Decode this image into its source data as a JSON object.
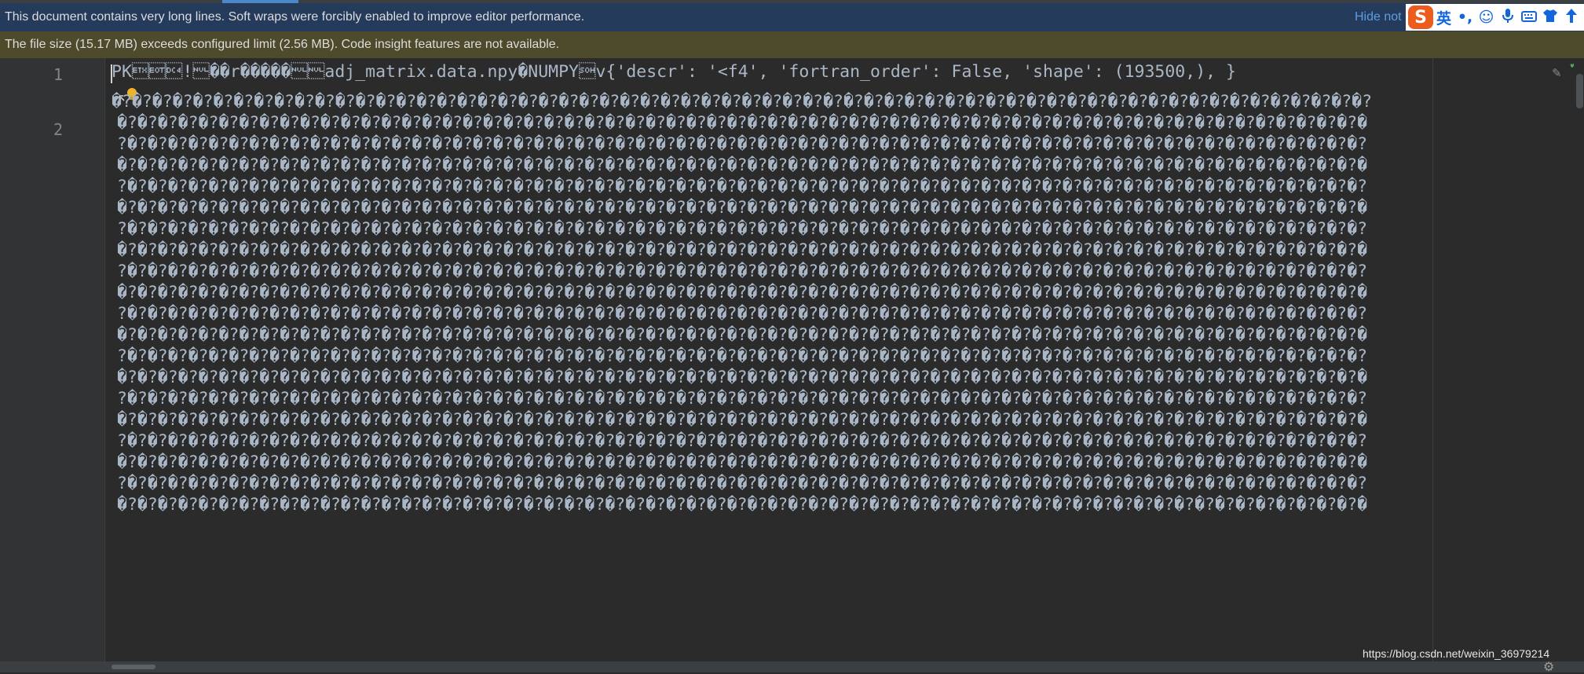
{
  "notification": {
    "message": "This document contains very long lines. Soft wraps were forcibly enabled to improve editor performance.",
    "hide_label": "Hide not"
  },
  "warning": {
    "message": "The file size (15.17 MB) exceeds configured limit (2.56 MB). Code insight features are not available."
  },
  "ime_toolbar": {
    "logo": "S",
    "lang": "英",
    "punct": "•,",
    "emoji_icon": "smiley-icon",
    "mic_icon": "microphone-icon",
    "keyboard_icon": "keyboard-icon",
    "skin_icon": "shirt-icon",
    "more_icon": "arrow-up-icon"
  },
  "editor": {
    "line_numbers": [
      "1",
      "2"
    ],
    "line1": "PK\u0003\u0004\u0014!\u0000��r�����\u0000\u0000adj_matrix.data.npy�NUMPY\u0001v{'descr': '<f4', 'fortran_order': False, 'shape': (193500,), }",
    "wrapped_lines": [
      "�?�?�?�?�?�?�?�?�?�?�?�?�?�?�?�?�?�?�?�?�?�?�?�?�?�?�?�?�?�?�?�?�?�?�?�?�?�?�?�?�?�?�?�?�?�?�?�?�?�?�?�?�?�?�?�?�?�?�?�?�?�?",
      "�?�?�?�?�?�?�?�?�?�?�?�?�?�?�?�?�?�?�?�?�?�?�?�?�?�?�?�?�?�?�?�?�?�?�?�?�?�?�?�?�?�?�?�?�?�?�?�?�?�?�?�?�?�?�?�?�?�?�?�?�?�",
      "?�?�?�?�?�?�?�?�?�?�?�?�?�?�?�?�?�?�?�?�?�?�?�?�?�?�?�?�?�?�?�?�?�?�?�?�?�?�?�?�?�?�?�?�?�?�?�?�?�?�?�?�?�?�?�?�?�?�?�?�?�?",
      "�?�?�?�?�?�?�?�?�?�?�?�?�?�?�?�?�?�?�?�?�?�?�?�?�?�?�?�?�?�?�?�?�?�?�?�?�?�?�?�?�?�?�?�?�?�?�?�?�?�?�?�?�?�?�?�?�?�?�?�?�?�",
      "?�?�?�?�?�?�?�?�?�?�?�?�?�?�?�?�?�?�?�?�?�?�?�?�?�?�?�?�?�?�?�?�?�?�?�?�?�?�?�?�?�?�?�?�?�?�?�?�?�?�?�?�?�?�?�?�?�?�?�?�?�?",
      "�?�?�?�?�?�?�?�?�?�?�?�?�?�?�?�?�?�?�?�?�?�?�?�?�?�?�?�?�?�?�?�?�?�?�?�?�?�?�?�?�?�?�?�?�?�?�?�?�?�?�?�?�?�?�?�?�?�?�?�?�?�",
      "?�?�?�?�?�?�?�?�?�?�?�?�?�?�?�?�?�?�?�?�?�?�?�?�?�?�?�?�?�?�?�?�?�?�?�?�?�?�?�?�?�?�?�?�?�?�?�?�?�?�?�?�?�?�?�?�?�?�?�?�?�?",
      "�?�?�?�?�?�?�?�?�?�?�?�?�?�?�?�?�?�?�?�?�?�?�?�?�?�?�?�?�?�?�?�?�?�?�?�?�?�?�?�?�?�?�?�?�?�?�?�?�?�?�?�?�?�?�?�?�?�?�?�?�?�",
      "?�?�?�?�?�?�?�?�?�?�?�?�?�?�?�?�?�?�?�?�?�?�?�?�?�?�?�?�?�?�?�?�?�?�?�?�?�?�?�?�?�?�?�?�?�?�?�?�?�?�?�?�?�?�?�?�?�?�?�?�?�?",
      "�?�?�?�?�?�?�?�?�?�?�?�?�?�?�?�?�?�?�?�?�?�?�?�?�?�?�?�?�?�?�?�?�?�?�?�?�?�?�?�?�?�?�?�?�?�?�?�?�?�?�?�?�?�?�?�?�?�?�?�?�?�",
      "?�?�?�?�?�?�?�?�?�?�?�?�?�?�?�?�?�?�?�?�?�?�?�?�?�?�?�?�?�?�?�?�?�?�?�?�?�?�?�?�?�?�?�?�?�?�?�?�?�?�?�?�?�?�?�?�?�?�?�?�?�?",
      "�?�?�?�?�?�?�?�?�?�?�?�?�?�?�?�?�?�?�?�?�?�?�?�?�?�?�?�?�?�?�?�?�?�?�?�?�?�?�?�?�?�?�?�?�?�?�?�?�?�?�?�?�?�?�?�?�?�?�?�?�?�",
      "?�?�?�?�?�?�?�?�?�?�?�?�?�?�?�?�?�?�?�?�?�?�?�?�?�?�?�?�?�?�?�?�?�?�?�?�?�?�?�?�?�?�?�?�?�?�?�?�?�?�?�?�?�?�?�?�?�?�?�?�?�?",
      "�?�?�?�?�?�?�?�?�?�?�?�?�?�?�?�?�?�?�?�?�?�?�?�?�?�?�?�?�?�?�?�?�?�?�?�?�?�?�?�?�?�?�?�?�?�?�?�?�?�?�?�?�?�?�?�?�?�?�?�?�?�",
      "?�?�?�?�?�?�?�?�?�?�?�?�?�?�?�?�?�?�?�?�?�?�?�?�?�?�?�?�?�?�?�?�?�?�?�?�?�?�?�?�?�?�?�?�?�?�?�?�?�?�?�?�?�?�?�?�?�?�?�?�?�?",
      "�?�?�?�?�?�?�?�?�?�?�?�?�?�?�?�?�?�?�?�?�?�?�?�?�?�?�?�?�?�?�?�?�?�?�?�?�?�?�?�?�?�?�?�?�?�?�?�?�?�?�?�?�?�?�?�?�?�?�?�?�?�",
      "?�?�?�?�?�?�?�?�?�?�?�?�?�?�?�?�?�?�?�?�?�?�?�?�?�?�?�?�?�?�?�?�?�?�?�?�?�?�?�?�?�?�?�?�?�?�?�?�?�?�?�?�?�?�?�?�?�?�?�?�?�?",
      "�?�?�?�?�?�?�?�?�?�?�?�?�?�?�?�?�?�?�?�?�?�?�?�?�?�?�?�?�?�?�?�?�?�?�?�?�?�?�?�?�?�?�?�?�?�?�?�?�?�?�?�?�?�?�?�?�?�?�?�?�?�",
      "?�?�?�?�?�?�?�?�?�?�?�?�?�?�?�?�?�?�?�?�?�?�?�?�?�?�?�?�?�?�?�?�?�?�?�?�?�?�?�?�?�?�?�?�?�?�?�?�?�?�?�?�?�?�?�?�?�?�?�?�?�?",
      "�?�?�?�?�?�?�?�?�?�?�?�?�?�?�?�?�?�?�?�?�?�?�?�?�?�?�?�?�?�?�?�?�?�?�?�?�?�?�?�?�?�?�?�?�?�?�?�?�?�?�?�?�?�?�?�?�?�?�?�?�?�"
    ]
  },
  "watermark": "https://blog.csdn.net/weixin_36979214",
  "colors": {
    "notification_bg": "#253b5c",
    "warning_bg": "#4d4b2b",
    "editor_bg": "#2b2b2b",
    "gutter_bg": "#313335",
    "text": "#a9b7c6",
    "link": "#5d9de0",
    "bulb": "#f0b429"
  }
}
